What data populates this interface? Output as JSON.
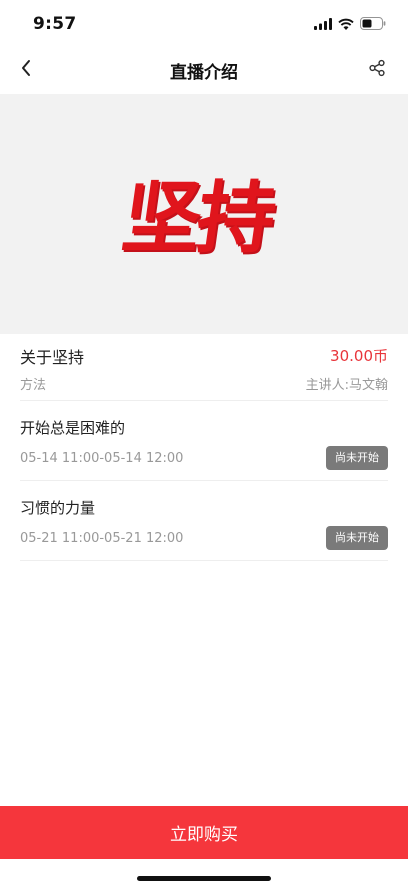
{
  "status_bar": {
    "time": "9:57"
  },
  "nav": {
    "title": "直播介绍",
    "back_icon": "chevron-left-icon",
    "share_icon": "share-icon"
  },
  "cover": {
    "title": "坚持",
    "title_color": "#e0151c"
  },
  "course": {
    "title": "关于坚持",
    "price": "30.00币",
    "category": "方法",
    "lecturer": "主讲人:马文翰"
  },
  "sessions": [
    {
      "title": "开始总是困难的",
      "time": "05-14 11:00-05-14 12:00",
      "status": "尚未开始"
    },
    {
      "title": "习惯的力量",
      "time": "05-21 11:00-05-21 12:00",
      "status": "尚未开始"
    }
  ],
  "buy": {
    "label": "立即购买",
    "color": "#f5363c"
  },
  "colors": {
    "accent": "#e8343a",
    "badge": "#7a7a7a"
  }
}
